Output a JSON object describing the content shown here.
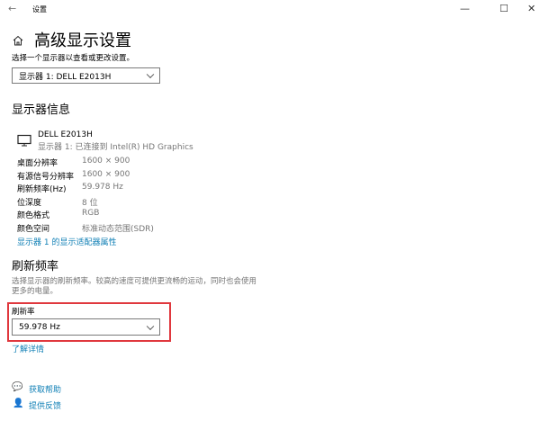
{
  "window": {
    "title": "设置",
    "back_icon": "←",
    "minimize": "—",
    "maximize": "☐",
    "close": "✕"
  },
  "page": {
    "title": "高级显示设置",
    "prompt": "选择一个显示器以查看或更改设置。",
    "display_select": "显示器 1: DELL E2013H"
  },
  "info": {
    "heading": "显示器信息",
    "monitor_name": "DELL E2013H",
    "monitor_sub": "显示器 1: 已连接到 Intel(R) HD Graphics",
    "rows": [
      {
        "label": "桌面分辨率",
        "value": "1600 × 900"
      },
      {
        "label": "有源信号分辨率",
        "value": "1600 × 900"
      },
      {
        "label": "刷新频率(Hz)",
        "value": "59.978 Hz"
      },
      {
        "label": "位深度",
        "value": "8 位"
      },
      {
        "label": "颜色格式",
        "value": "RGB"
      },
      {
        "label": "颜色空间",
        "value": "标准动态范围(SDR)"
      }
    ],
    "adapter_link": "显示器 1 的显示适配器属性"
  },
  "refresh": {
    "heading": "刷新频率",
    "desc1": "选择显示器的刷新频率。较高的速度可提供更流畅的运动，同时也会使用",
    "desc2": "更多的电量。",
    "label": "刷新率",
    "value": "59.978 Hz",
    "learn_more": "了解详情"
  },
  "footer": {
    "help": "获取帮助",
    "feedback": "提供反馈"
  },
  "colors": {
    "accent": "#0f7fb5",
    "highlight": "#e0383e"
  }
}
